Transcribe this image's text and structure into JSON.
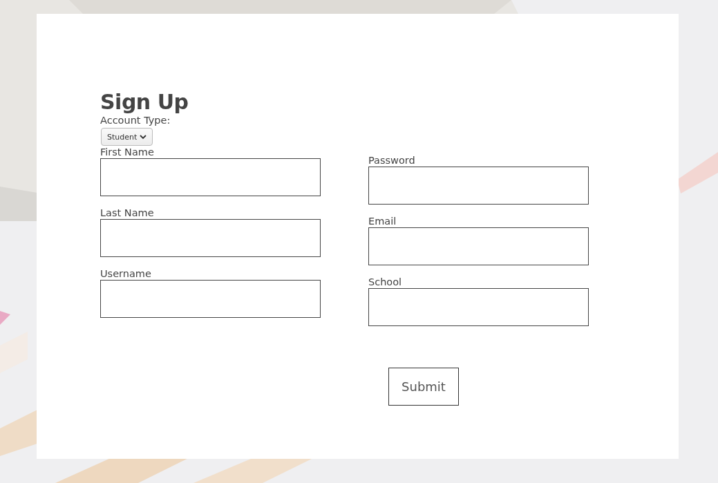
{
  "title": "Sign Up",
  "account_type": {
    "label": "Account Type:",
    "value": "Student"
  },
  "columns": [
    [
      {
        "label": "First Name"
      },
      {
        "label": "Last Name"
      },
      {
        "label": "Username"
      }
    ],
    [
      {
        "label": "Password"
      },
      {
        "label": "Email"
      },
      {
        "label": "School"
      }
    ]
  ],
  "submit": "Submit"
}
